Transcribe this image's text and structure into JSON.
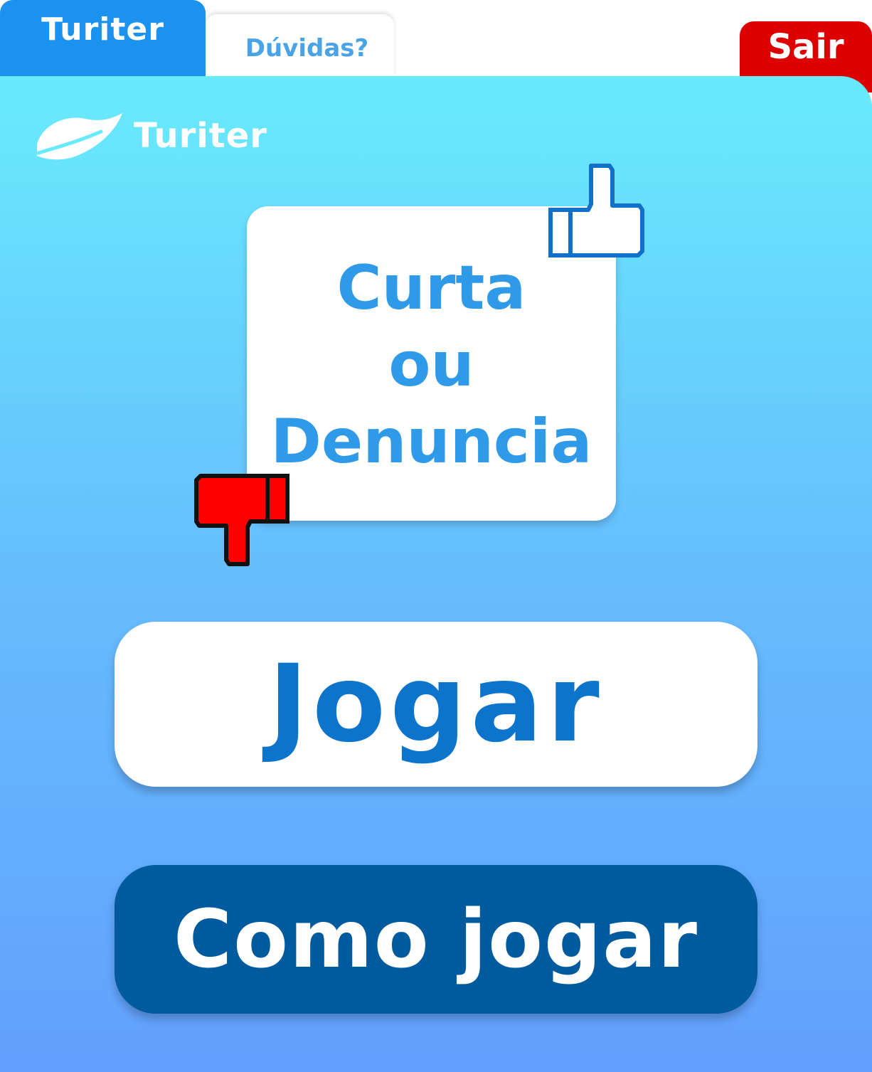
{
  "tabs": {
    "active_label": "Turiter",
    "help_label": "Dúvidas?",
    "exit_label": "Sair"
  },
  "brand": {
    "name": "Turiter",
    "icon": "leaf-icon"
  },
  "game_logo": {
    "line1": "Curta",
    "line2": "ou",
    "line3": "Denuncia",
    "like_icon": "thumbs-up-icon",
    "dislike_icon": "thumbs-down-icon"
  },
  "buttons": {
    "play_label": "Jogar",
    "how_to_play_label": "Como jogar"
  },
  "colors": {
    "tab_active": "#1a92ee",
    "exit": "#dd0000",
    "play_text": "#0d74cc",
    "how_bg": "#005a9e",
    "logo_text": "#2f9ae8",
    "like": "#1170c8",
    "dislike": "#ff0000"
  }
}
